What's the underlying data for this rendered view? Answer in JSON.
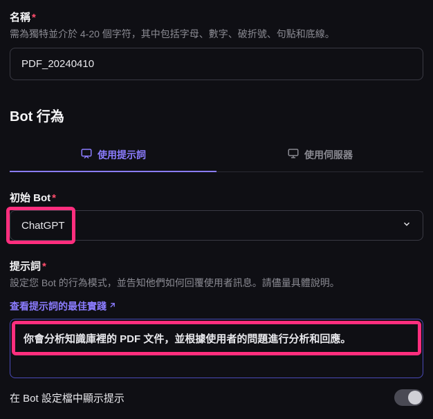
{
  "name_field": {
    "label": "名稱",
    "hint": "需為獨特並介於 4-20 個字符，其中包括字母、數字、破折號、句點和底線。",
    "value": "PDF_20240410"
  },
  "behavior_section": {
    "title": "Bot 行為"
  },
  "tabs": {
    "prompt": "使用提示詞",
    "server": "使用伺服器"
  },
  "initial_bot": {
    "label": "初始 Bot",
    "value": "ChatGPT"
  },
  "prompt_field": {
    "label": "提示詞",
    "hint": "設定您 Bot 的行為模式，並告知他們如何回覆使用者訊息。請儘量具體說明。",
    "link_text": "查看提示詞的最佳實踐",
    "value": "你會分析知識庫裡的 PDF 文件，並根據使用者的問題進行分析和回應。"
  },
  "toggle": {
    "label": "在 Bot 設定檔中顯示提示"
  }
}
